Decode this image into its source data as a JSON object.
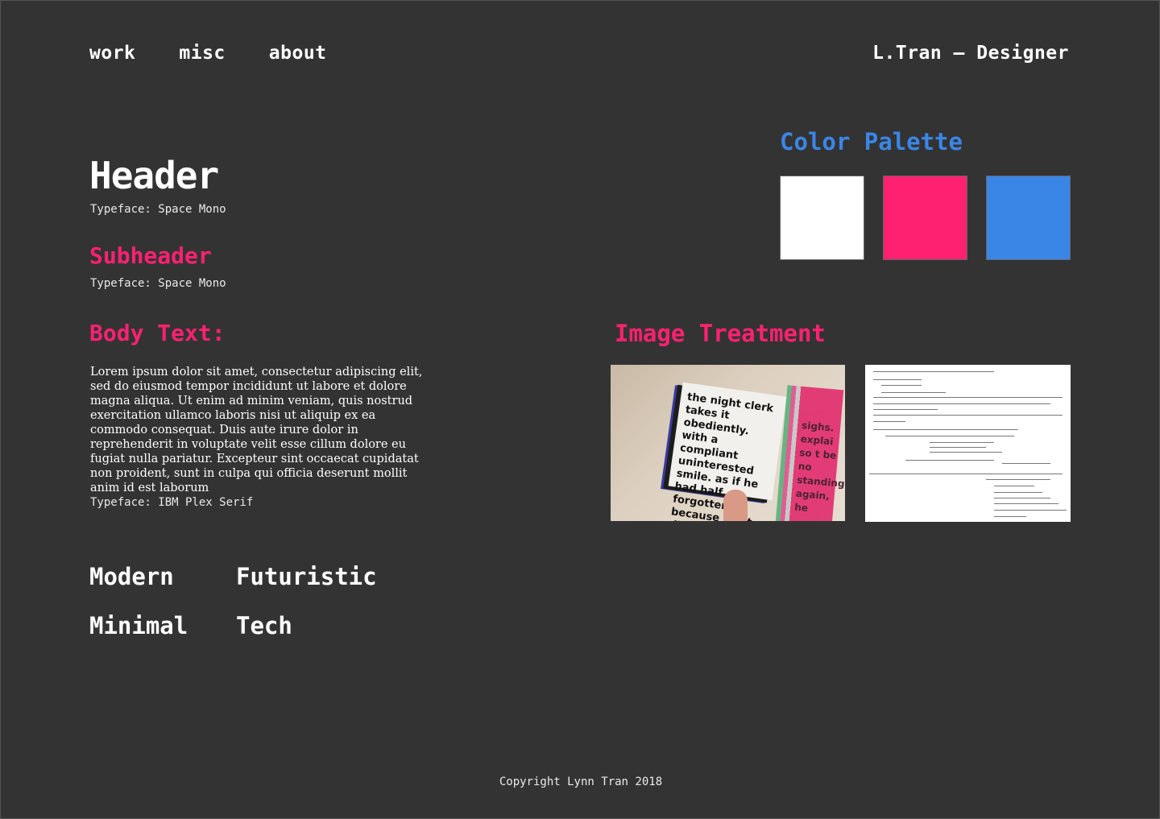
{
  "nav": {
    "items": [
      "work",
      "misc",
      "about"
    ]
  },
  "brand": "L.Tran — Designer",
  "typography": {
    "header": {
      "label": "Header",
      "caption": "Typeface: Space Mono"
    },
    "subheader": {
      "label": "Subheader",
      "caption": "Typeface: Space Mono"
    },
    "body": {
      "label": "Body Text:",
      "text": "Lorem ipsum dolor sit amet, consectetur adipiscing elit, sed do eiusmod tempor incididunt ut labore et dolore magna aliqua. Ut enim ad minim veniam, quis nostrud exercitation ullamco laboris nisi ut aliquip ex ea commodo consequat. Duis aute irure dolor in reprehenderit in voluptate velit esse cillum dolore eu fugiat nulla pariatur. Excepteur sint occaecat cupidatat non proident, sunt in culpa qui officia deserunt mollit anim id est laborum",
      "caption": "Typeface: IBM Plex Serif"
    }
  },
  "keywords": [
    {
      "text": "Modern",
      "color": "#3a86e6"
    },
    {
      "text": "Futuristic",
      "color": "#ff2171"
    },
    {
      "text": "Minimal",
      "color": "#ffffff"
    },
    {
      "text": "Tech",
      "color": "#3a86e6"
    }
  ],
  "palette": {
    "title": "Color Palette",
    "colors": [
      "#ffffff",
      "#ff2171",
      "#3a86e6"
    ]
  },
  "image_treatment": {
    "title": "Image Treatment",
    "book_text": "the night clerk takes it obediently. with a compliant uninterested smile. as if he had half forgotten because what did it matter,",
    "pages_text": "sighs. explai so t be no standing. again, he"
  },
  "footer": "Copyright Lynn Tran 2018",
  "colors": {
    "background": "#333333",
    "pink": "#ff2171",
    "blue": "#3a86e6"
  }
}
